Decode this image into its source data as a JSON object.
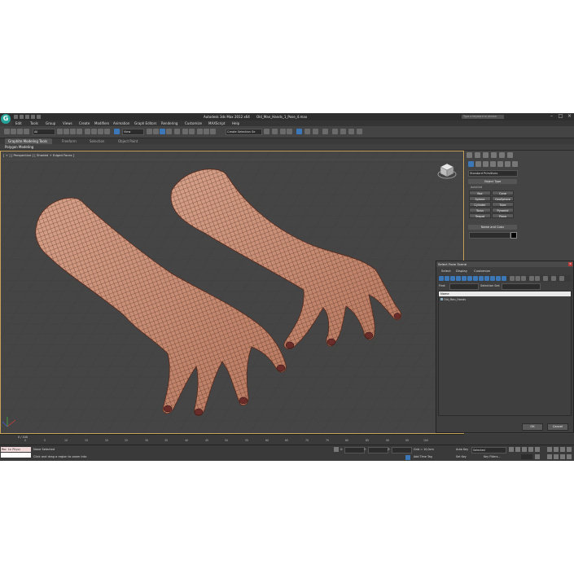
{
  "titlebar": {
    "app_title": "Autodesk 3ds Max  2012 x64",
    "file_name": "Old_Man_Hands_1_Pose_4.max",
    "search_placeholder": "Type a keyword or phrase"
  },
  "menubar": [
    "Edit",
    "Tools",
    "Group",
    "Views",
    "Create",
    "Modifiers",
    "Animation",
    "Graph Editors",
    "Rendering",
    "Customize",
    "MAXScript",
    "Help"
  ],
  "toolbar": {
    "selection_filter": "All",
    "reference_coord": "View",
    "named_selection": "Create Selection Se"
  },
  "ribbon": {
    "tabs": [
      "Graphite Modeling Tools",
      "Freeform",
      "Selection",
      "Object Paint"
    ],
    "active_panel": "Polygon Modeling"
  },
  "viewport": {
    "label": "[ + ] [ Perspective ] [ Shaded + Edged Faces ]"
  },
  "command_panel": {
    "category": "Standard Primitives",
    "object_type_title": "Object Type",
    "autogrid_label": "AutoGrid",
    "objects": [
      "Box",
      "Cone",
      "Sphere",
      "GeoSphere",
      "Cylinder",
      "Tube",
      "Torus",
      "Pyramid",
      "Teapot",
      "Plane"
    ],
    "name_color_title": "Name and Color"
  },
  "select_dialog": {
    "title": "Select From Scene",
    "menu": [
      "Select",
      "Display",
      "Customize"
    ],
    "find_label": "Find:",
    "selection_set_label": "Selection Set:",
    "column_header": "Name",
    "items": [
      "Old_Man_Hands"
    ],
    "ok_label": "OK",
    "cancel_label": "Cancel"
  },
  "timeline": {
    "frame_counter": "0 / 100",
    "ticks": [
      "0",
      "5",
      "10",
      "15",
      "20",
      "25",
      "30",
      "35",
      "40",
      "45",
      "50",
      "55",
      "60",
      "65",
      "70",
      "75",
      "80",
      "85",
      "90",
      "95",
      "100"
    ]
  },
  "status": {
    "maxscript_line1": "Max to Physc",
    "maxscript_line2": "",
    "selection_status": "None Selected",
    "prompt": "Click and drag a region to zoom into",
    "x_label": "X:",
    "y_label": "Y:",
    "z_label": "Z:",
    "grid": "Grid = 10,0cm",
    "add_time_tag": "Add Time Tag",
    "auto_key": "Auto Key",
    "set_key": "Set Key",
    "selected_mode": "Selected",
    "key_filters": "Key Filters..."
  },
  "colors": {
    "background": "#3b3b3b",
    "viewport_bg": "#454545",
    "viewport_border": "#c7a25a",
    "hand_skin": "#c98d72",
    "logo": "#25a59a"
  }
}
